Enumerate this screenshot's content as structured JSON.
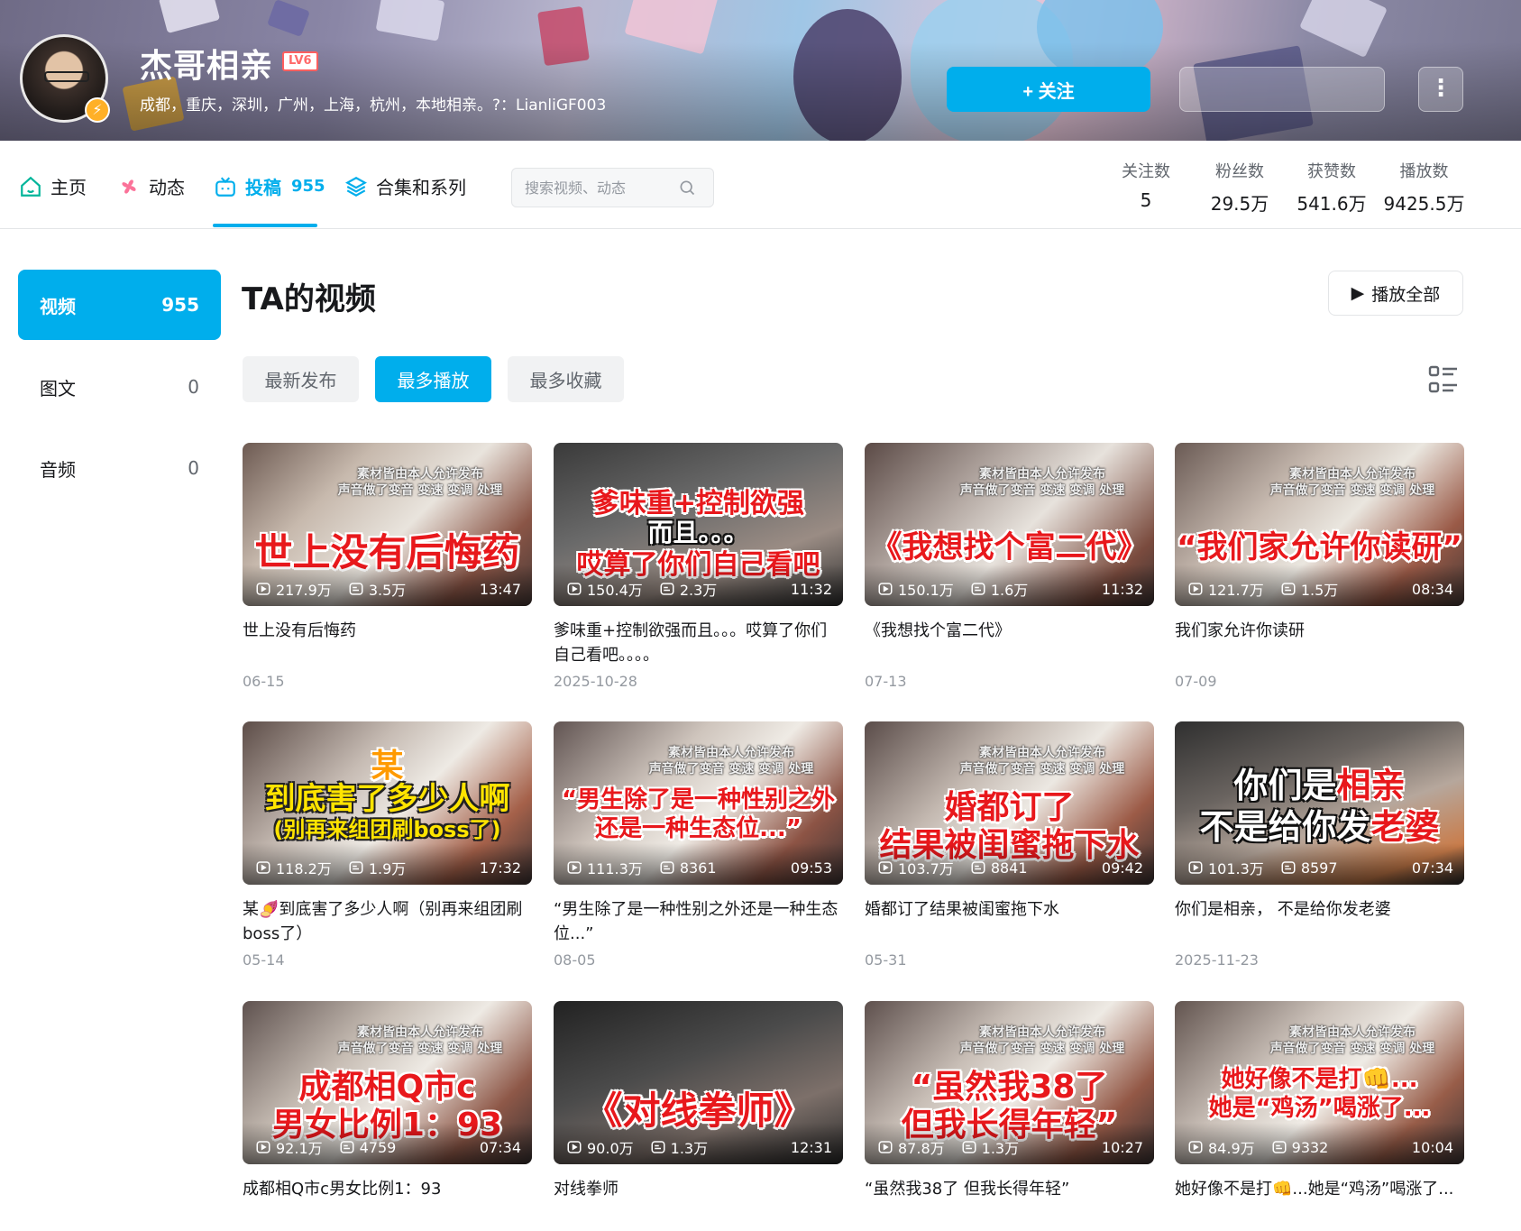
{
  "header": {
    "username": "杰哥相亲",
    "level": "LV6",
    "sign": "成都，重庆，深圳，广州，上海，杭州，本地相亲。?：LianliGF003",
    "follow_label": "+ 关注",
    "more_icon": "more-vertical-icon"
  },
  "nav": {
    "tabs": [
      {
        "label": "主页",
        "icon": "home-icon"
      },
      {
        "label": "动态",
        "icon": "pinwheel-icon"
      },
      {
        "label": "投稿",
        "count": "955",
        "icon": "tv-icon"
      },
      {
        "label": "合集和系列",
        "icon": "layers-icon"
      }
    ],
    "search_placeholder": "搜索视频、动态",
    "stats": [
      {
        "label": "关注数",
        "value": "5"
      },
      {
        "label": "粉丝数",
        "value": "29.5万"
      },
      {
        "label": "获赞数",
        "value": "541.6万"
      },
      {
        "label": "播放数",
        "value": "9425.5万"
      }
    ]
  },
  "sidebar": {
    "items": [
      {
        "label": "视频",
        "count": "955"
      },
      {
        "label": "图文",
        "count": "0"
      },
      {
        "label": "音频",
        "count": "0"
      }
    ]
  },
  "main": {
    "title": "TA的视频",
    "play_all": "播放全部",
    "sort_tabs": [
      "最新发布",
      "最多播放",
      "最多收藏"
    ],
    "active_sort": "最多播放",
    "accent_color": "#00aeec",
    "watermark": "素材皆由本人允许发布\n声音做了变音 变速 变调 处理",
    "videos": [
      {
        "title": "世上没有后悔药",
        "plays": "217.9万",
        "danmaku": "3.5万",
        "duration": "13:47",
        "date": "06-15",
        "cap1": "世上没有后悔药",
        "cap2": ""
      },
      {
        "title": "爹味重+控制欲强而且。。。哎算了你们自己看吧。。。。",
        "plays": "150.4万",
        "danmaku": "2.3万",
        "duration": "11:32",
        "date": "2025-10-28",
        "cap1": "爹味重+控制欲强",
        "cap2": "而且。。。",
        "cap3": "哎算了你们自己看吧"
      },
      {
        "title": "《我想找个富二代》",
        "plays": "150.1万",
        "danmaku": "1.6万",
        "duration": "11:32",
        "date": "07-13",
        "cap1": "《我想找个富二代》",
        "cap2": ""
      },
      {
        "title": "我们家允许你读研",
        "plays": "121.7万",
        "danmaku": "1.5万",
        "duration": "08:34",
        "date": "07-09",
        "cap1": "“我们家允许你读研”",
        "cap2": ""
      },
      {
        "title": "某🍠到底害了多少人啊（别再来组团刷boss了）",
        "plays": "118.2万",
        "danmaku": "1.9万",
        "duration": "17:32",
        "date": "05-14",
        "cap1": "某",
        "cap2": "到底害了多少人啊",
        "cap3": "(别再来组团刷boss了)"
      },
      {
        "title": "“男生除了是一种性别之外还是一种生态位...”",
        "plays": "111.3万",
        "danmaku": "8361",
        "duration": "09:53",
        "date": "08-05",
        "cap1": "“男生除了是一种性别之外",
        "cap2": "还是一种生态位...”"
      },
      {
        "title": "婚都订了结果被闺蜜拖下水",
        "plays": "103.7万",
        "danmaku": "8841",
        "duration": "09:42",
        "date": "05-31",
        "cap1": "婚都订了",
        "cap2": "结果被闺蜜拖下水"
      },
      {
        "title": "你们是相亲， 不是给你发老婆",
        "plays": "101.3万",
        "danmaku": "8597",
        "duration": "07:34",
        "date": "2025-11-23",
        "cap1a": "你们是",
        "cap1b": "相亲",
        "cap2a": "不是给你发",
        "cap2b": "老婆"
      },
      {
        "title": "成都相Q市c男女比例1：93",
        "plays": "92.1万",
        "danmaku": "4759",
        "duration": "07:34",
        "date": "",
        "cap1": "成都相Q市c",
        "cap2": "男女比例1：93"
      },
      {
        "title": "对线拳师",
        "plays": "90.0万",
        "danmaku": "1.3万",
        "duration": "12:31",
        "date": "",
        "cap1": "《对线拳师》",
        "cap2": ""
      },
      {
        "title": "“虽然我38了 但我长得年轻”",
        "plays": "87.8万",
        "danmaku": "1.3万",
        "duration": "10:27",
        "date": "",
        "cap1": "“虽然我38了",
        "cap2": "但我长得年轻”"
      },
      {
        "title": "她好像不是打👊...她是“鸡汤”喝涨了...",
        "plays": "84.9万",
        "danmaku": "9332",
        "duration": "10:04",
        "date": "",
        "cap1": "她好像不是打👊...",
        "cap2": "她是“鸡汤”喝涨了..."
      }
    ]
  }
}
